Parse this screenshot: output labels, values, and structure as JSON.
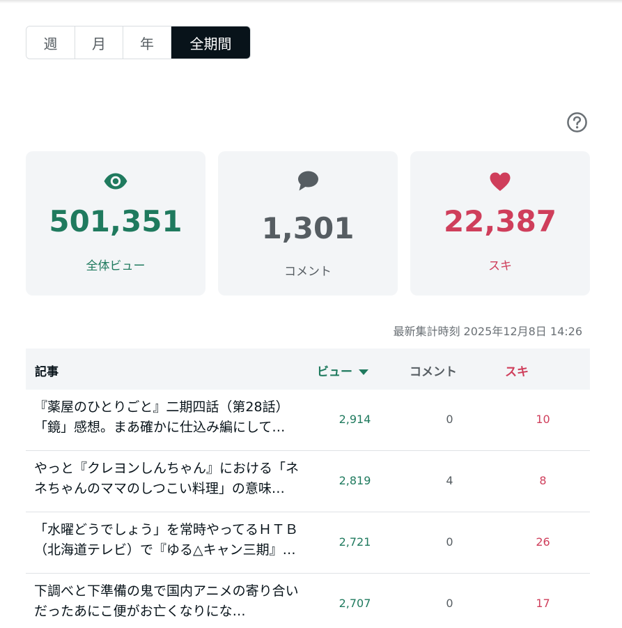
{
  "period_tabs": [
    {
      "label": "週",
      "active": false
    },
    {
      "label": "月",
      "active": false
    },
    {
      "label": "年",
      "active": false
    },
    {
      "label": "全期間",
      "active": true
    }
  ],
  "stats": {
    "views": {
      "value": "501,351",
      "label": "全体ビュー",
      "icon": "eye-icon",
      "color": "#1f7a5e"
    },
    "comments": {
      "value": "1,301",
      "label": "コメント",
      "icon": "speech-bubble-icon",
      "color": "#565d62"
    },
    "likes": {
      "value": "22,387",
      "label": "スキ",
      "icon": "heart-icon",
      "color": "#cf3e5b"
    }
  },
  "updated_at": "最新集計時刻 2025年12月8日 14:26",
  "table": {
    "headers": {
      "article": "記事",
      "views": "ビュー",
      "comments": "コメント",
      "likes": "スキ"
    },
    "sort": {
      "column": "views",
      "direction": "desc"
    },
    "rows": [
      {
        "title": "『薬屋のひとりごと』二期四話（第28話）「鏡」感想。まあ確かに仕込み編にして…",
        "views": "2,914",
        "comments": "0",
        "likes": "10"
      },
      {
        "title": "やっと『クレヨンしんちゃん』における「ネネちゃんのママのしつこい料理」の意味…",
        "views": "2,819",
        "comments": "4",
        "likes": "8"
      },
      {
        "title": "「水曜どうでしょう」を常時やってるＨＴＢ（北海道テレビ）で『ゆる△キャン三期』…",
        "views": "2,721",
        "comments": "0",
        "likes": "26"
      },
      {
        "title": "下調べと下準備の鬼で国内アニメの寄り合いだったあにこ便がお亡くなりにな…",
        "views": "2,707",
        "comments": "0",
        "likes": "17"
      }
    ]
  }
}
